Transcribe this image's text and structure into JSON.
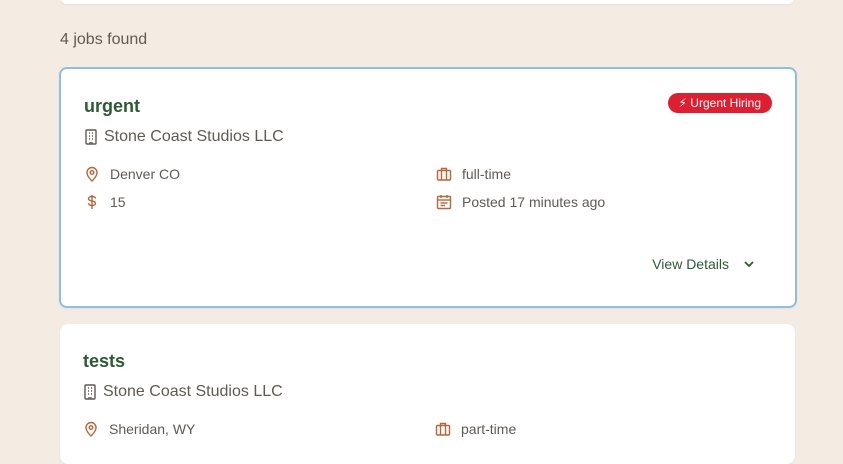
{
  "results": {
    "count_text": "4 jobs found"
  },
  "jobs": [
    {
      "title": "urgent",
      "company": "Stone Coast Studios LLC",
      "location": "Denver CO",
      "salary": "15",
      "type": "full-time",
      "posted": "Posted 17 minutes ago",
      "badge": "⚡ Urgent Hiring",
      "view_details": "View Details"
    },
    {
      "title": "tests",
      "company": "Stone Coast Studios LLC",
      "location": "Sheridan, WY",
      "type": "part-time"
    }
  ],
  "colors": {
    "accent_green": "#2d5a35",
    "icon_orange": "#b8653a",
    "badge_red": "#dc2032",
    "highlight_border": "#8fbfe0",
    "page_bg": "#f4ece3"
  }
}
